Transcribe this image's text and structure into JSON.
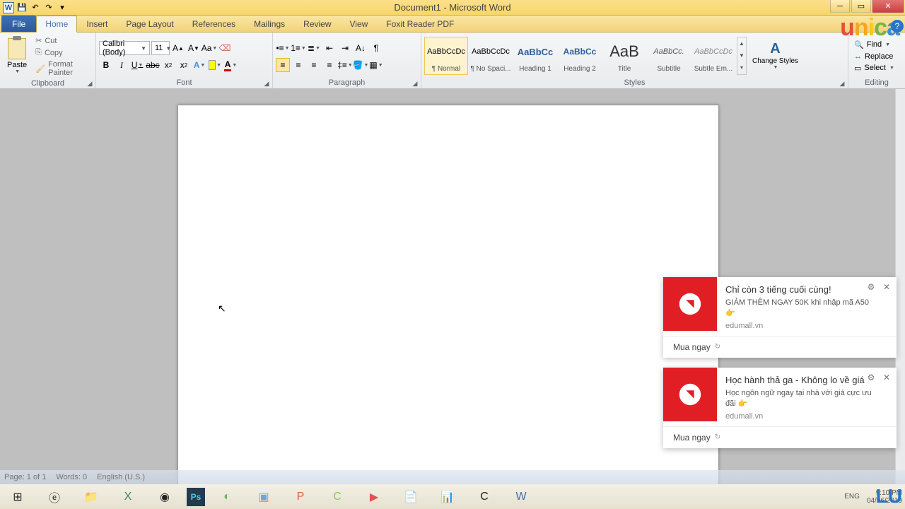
{
  "title": "Document1 - Microsoft Word",
  "tabs": {
    "file": "File",
    "home": "Home",
    "insert": "Insert",
    "pagelayout": "Page Layout",
    "references": "References",
    "mailings": "Mailings",
    "review": "Review",
    "view": "View",
    "foxit": "Foxit Reader PDF"
  },
  "clipboard": {
    "paste": "Paste",
    "cut": "Cut",
    "copy": "Copy",
    "format_painter": "Format Painter",
    "label": "Clipboard"
  },
  "font": {
    "name": "Calibri (Body)",
    "size": "11",
    "label": "Font"
  },
  "paragraph": {
    "label": "Paragraph"
  },
  "styles": {
    "label": "Styles",
    "items": [
      {
        "preview": "AaBbCcDc",
        "name": "¶ Normal",
        "css": "font-size:11px;"
      },
      {
        "preview": "AaBbCcDc",
        "name": "¶ No Spaci...",
        "css": "font-size:11px;"
      },
      {
        "preview": "AaBbCc",
        "name": "Heading 1",
        "css": "font-size:13px;color:#2e5f9b;font-weight:bold;"
      },
      {
        "preview": "AaBbCc",
        "name": "Heading 2",
        "css": "font-size:12px;color:#2e5f9b;font-weight:bold;"
      },
      {
        "preview": "AaB",
        "name": "Title",
        "css": "font-size:22px;color:#333;"
      },
      {
        "preview": "AaBbCc.",
        "name": "Subtitle",
        "css": "font-size:11px;font-style:italic;color:#555;"
      },
      {
        "preview": "AaBbCcDc",
        "name": "Subtle Em...",
        "css": "font-size:11px;font-style:italic;color:#888;"
      }
    ],
    "change": "Change Styles"
  },
  "editing": {
    "find": "Find",
    "replace": "Replace",
    "select": "Select",
    "label": "Editing"
  },
  "status": {
    "page": "Page: 1 of 1",
    "words": "Words: 0",
    "lang": "English (U.S.)"
  },
  "tray": {
    "lang": "ENG",
    "time": "9:10 PM",
    "date": "04/06/2019"
  },
  "notifications": [
    {
      "title": "Chỉ còn 3 tiếng cuối cùng!",
      "message": "GIẢM THÊM NGAY 50K khi nhập mã A50 👉",
      "source": "edumall.vn",
      "action": "Mua ngay"
    },
    {
      "title": "Học hành thả ga - Không lo về giá",
      "message": "Học ngôn ngữ ngay tại nhà với giá cực ưu đãi 👉",
      "source": "edumall.vn",
      "action": "Mua ngay"
    }
  ],
  "watermark": {
    "unica": "unica",
    "lu": "LU"
  }
}
